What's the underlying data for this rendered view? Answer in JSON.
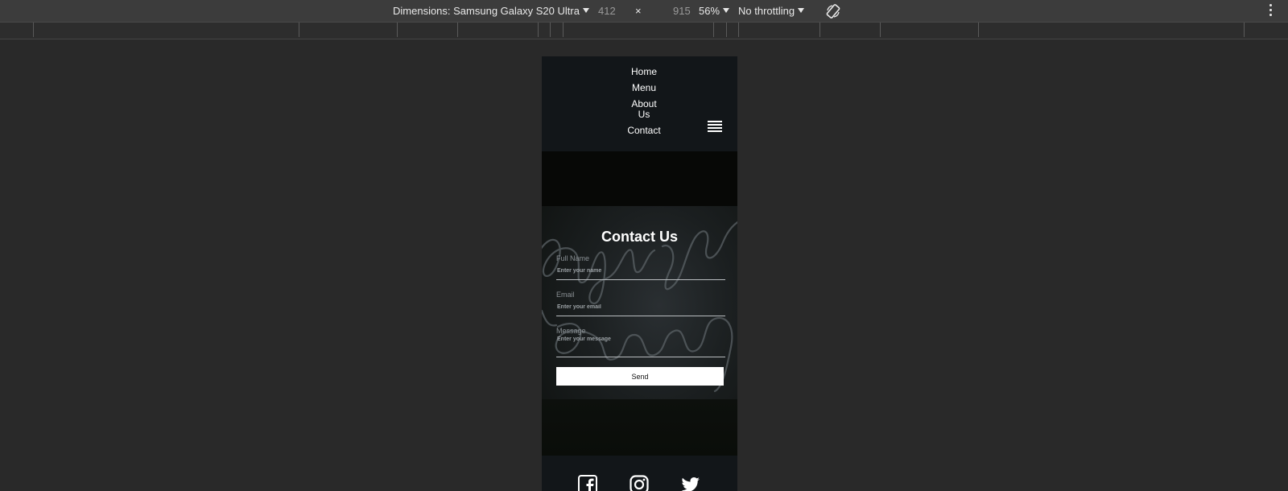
{
  "devtools": {
    "dimensions_label": "Dimensions: Samsung Galaxy S20 Ultra",
    "width": "412",
    "times": "×",
    "height": "915",
    "zoom": "56%",
    "throttling": "No throttling",
    "icons": [
      "dropdown-caret-icon",
      "rotate-icon",
      "more-options-icon"
    ]
  },
  "nav": {
    "links": [
      "Home",
      "Menu",
      "About Us",
      "Contact"
    ],
    "menu_icon": "hamburger-icon"
  },
  "contact": {
    "title": "Contact Us",
    "full_name_label": "Full Name",
    "full_name_placeholder": "Enter your name",
    "email_label": "Email",
    "email_placeholder": "Enter your email",
    "message_label": "Message",
    "message_placeholder": "Enter your message",
    "send_label": "Send"
  },
  "footer": {
    "social_icons": [
      "facebook-icon",
      "instagram-icon",
      "twitter-icon"
    ]
  },
  "colors": {
    "devtools_bg": "#3c3c3c",
    "page_bg": "#292929",
    "nav_bg": "#121619",
    "button_bg": "#ffffff"
  }
}
